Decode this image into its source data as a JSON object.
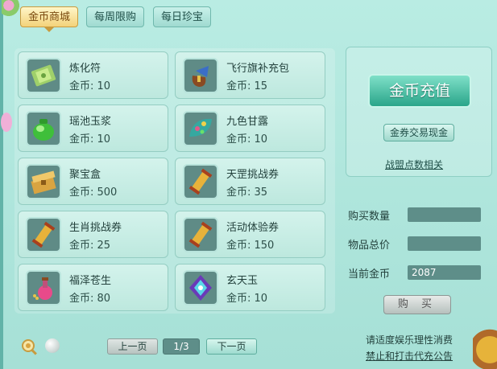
{
  "tabs": [
    {
      "label": "金币商城",
      "active": true
    },
    {
      "label": "每周限购",
      "active": false
    },
    {
      "label": "每日珍宝",
      "active": false
    }
  ],
  "items": [
    {
      "name": "炼化符",
      "price": "金币: 10",
      "icon": "talisman-icon"
    },
    {
      "name": "飞行旗补充包",
      "price": "金币: 15",
      "icon": "flag-pack-icon"
    },
    {
      "name": "瑶池玉浆",
      "price": "金币: 10",
      "icon": "jade-jar-icon"
    },
    {
      "name": "九色甘露",
      "price": "金币: 10",
      "icon": "dew-leaf-icon"
    },
    {
      "name": "聚宝盒",
      "price": "金币: 500",
      "icon": "treasure-box-icon"
    },
    {
      "name": "天罡挑战券",
      "price": "金币: 35",
      "icon": "scroll-icon"
    },
    {
      "name": "生肖挑战券",
      "price": "金币: 25",
      "icon": "scroll-icon"
    },
    {
      "name": "活动体验券",
      "price": "金币: 150",
      "icon": "scroll-icon"
    },
    {
      "name": "福泽苍生",
      "price": "金币: 80",
      "icon": "potion-icon"
    },
    {
      "name": "玄天玉",
      "price": "金币: 10",
      "icon": "jade-gem-icon"
    }
  ],
  "right_panel": {
    "recharge_label": "金币充值",
    "exchange_label": "金券交易现金",
    "alliance_label": "战盟点数相关"
  },
  "purchase": {
    "quantity_label": "购买数量",
    "quantity_value": "",
    "total_label": "物品总价",
    "total_value": "",
    "gold_label": "当前金币",
    "gold_value": "2087",
    "buy_label": "购 买"
  },
  "pagination": {
    "prev_label": "上一页",
    "page_text": "1/3",
    "next_label": "下一页"
  },
  "notices": {
    "line1": "请适度娱乐理性消费",
    "line2": "禁止和打击代充公告"
  },
  "colors": {
    "background": "#a6e0d6",
    "active_tab": "#f3d27a",
    "recharge_button": "#2aa58a",
    "input_box": "#5e8e89"
  }
}
